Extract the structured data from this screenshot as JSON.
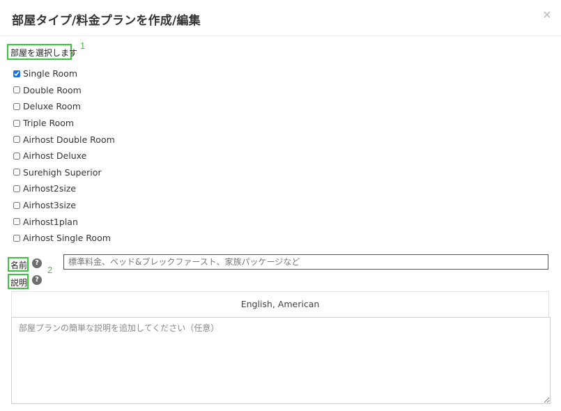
{
  "header": {
    "title": "部屋タイプ/料金プランを作成/編集",
    "close_symbol": "×"
  },
  "annotations": {
    "marker_1": "1",
    "marker_2": "2"
  },
  "room_section": {
    "label": "部屋を選択します",
    "rooms": [
      {
        "label": "Single Room",
        "checked": true
      },
      {
        "label": "Double Room",
        "checked": false
      },
      {
        "label": "Deluxe Room",
        "checked": false
      },
      {
        "label": "Triple Room",
        "checked": false
      },
      {
        "label": "Airhost Double Room",
        "checked": false
      },
      {
        "label": "Airhost Deluxe",
        "checked": false
      },
      {
        "label": "Surehigh Superior",
        "checked": false
      },
      {
        "label": "Airhost2size",
        "checked": false
      },
      {
        "label": "Airhost3size",
        "checked": false
      },
      {
        "label": "Airhost1plan",
        "checked": false
      },
      {
        "label": "Airhost Single Room",
        "checked": false
      }
    ]
  },
  "name_field": {
    "label": "名前",
    "help_symbol": "?",
    "placeholder": "標準料金、ベッド&ブレックファースト、家族パッケージなど",
    "value": ""
  },
  "description_field": {
    "label": "説明",
    "help_symbol": "?",
    "language_tab": "English, American",
    "placeholder": "部屋プランの簡単な説明を追加してください（任意）",
    "value": ""
  },
  "colors": {
    "annotation": "#3dc43d",
    "help_icon": "#6d6d6d",
    "checkbox_accent": "#1a73e8"
  }
}
